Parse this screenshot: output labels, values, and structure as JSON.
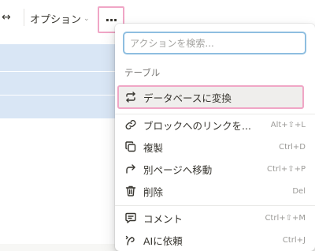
{
  "toolbar": {
    "arrows": "↔",
    "options_label": "オプション",
    "more_label": "···"
  },
  "menu": {
    "search_placeholder": "アクションを検索...",
    "section_label": "テーブル",
    "items": [
      {
        "label": "データベースに変換",
        "shortcut": "",
        "icon": "convert-icon"
      },
      {
        "label": "ブロックへのリンクを...",
        "shortcut": "Alt+⇧+L",
        "icon": "link-icon"
      },
      {
        "label": "複製",
        "shortcut": "Ctrl+D",
        "icon": "duplicate-icon"
      },
      {
        "label": "別ページへ移動",
        "shortcut": "Ctrl+⇧+P",
        "icon": "move-icon"
      },
      {
        "label": "削除",
        "shortcut": "Del",
        "icon": "trash-icon"
      },
      {
        "label": "コメント",
        "shortcut": "Ctrl+⇧+M",
        "icon": "comment-icon"
      },
      {
        "label": "AIに依頼",
        "shortcut": "Ctrl+J",
        "icon": "ai-icon"
      }
    ]
  },
  "colors": {
    "highlight_border": "#f0a6c6",
    "search_border": "#8ebee0",
    "table_fill": "#d9e6f5"
  }
}
